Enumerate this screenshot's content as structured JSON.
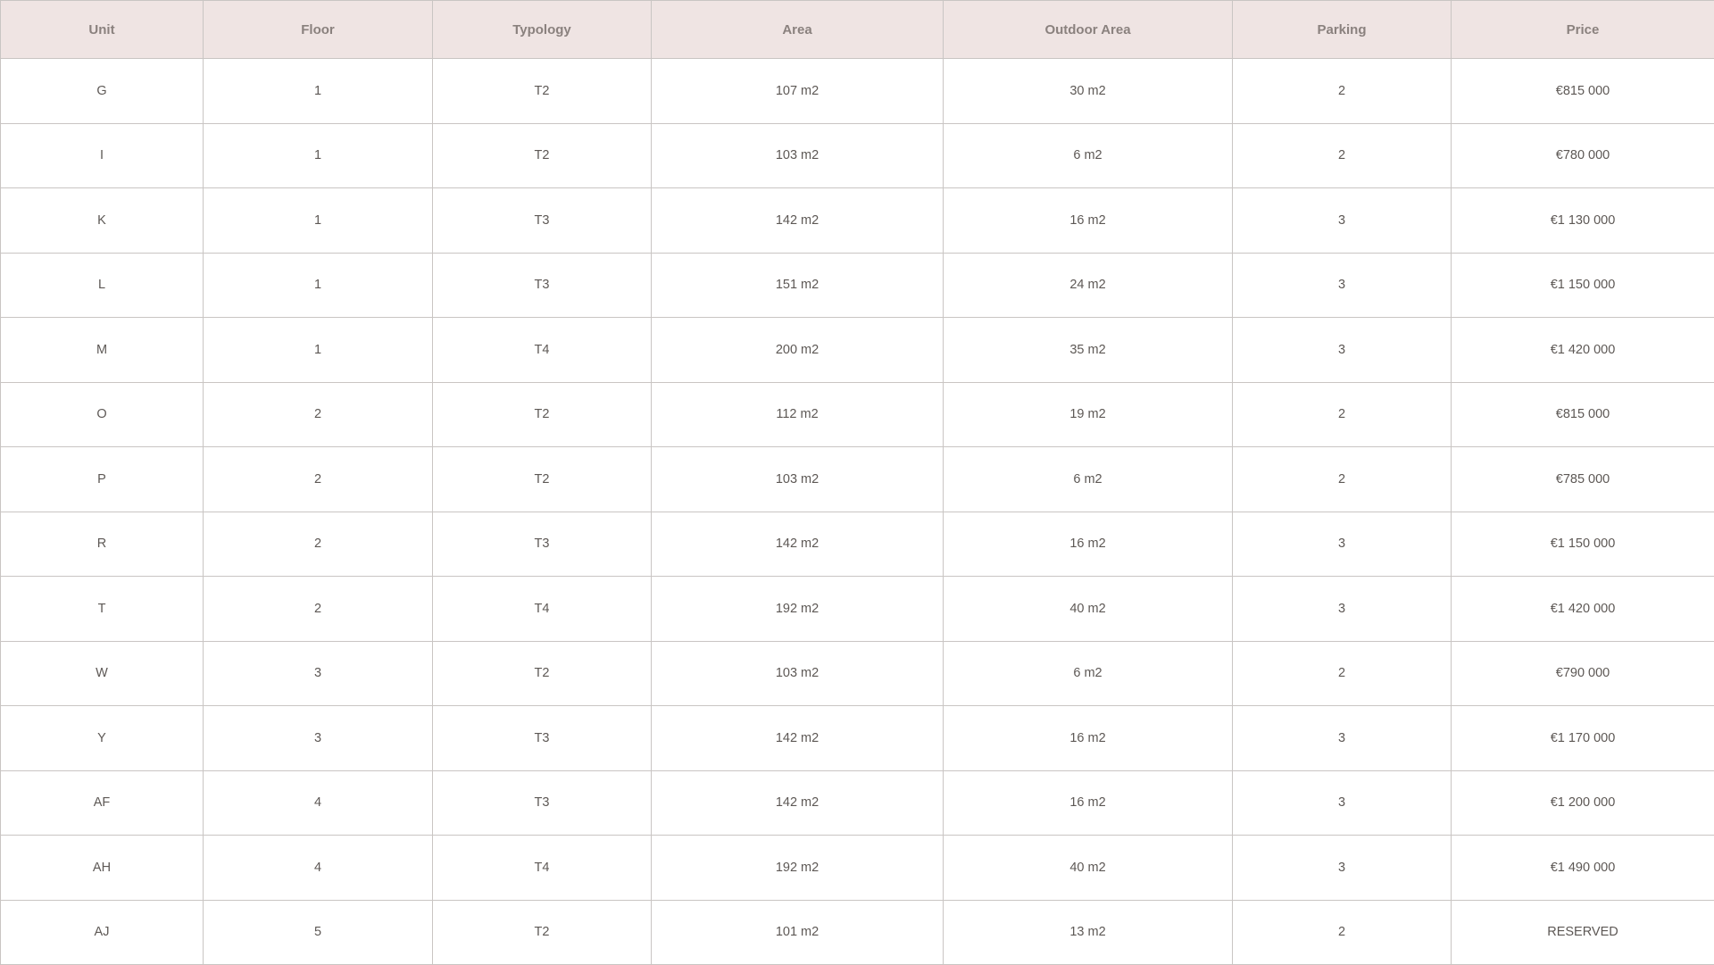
{
  "table": {
    "columns": [
      "Unit",
      "Floor",
      "Typology",
      "Area",
      "Outdoor Area",
      "Parking",
      "Price"
    ],
    "rows": [
      [
        "G",
        "1",
        "T2",
        "107 m2",
        "30 m2",
        "2",
        "€815 000"
      ],
      [
        "I",
        "1",
        "T2",
        "103 m2",
        "6 m2",
        "2",
        "€780 000"
      ],
      [
        "K",
        "1",
        "T3",
        "142 m2",
        "16 m2",
        "3",
        "€1 130 000"
      ],
      [
        "L",
        "1",
        "T3",
        "151 m2",
        "24 m2",
        "3",
        "€1 150 000"
      ],
      [
        "M",
        "1",
        "T4",
        "200 m2",
        "35 m2",
        "3",
        "€1 420 000"
      ],
      [
        "O",
        "2",
        "T2",
        "112 m2",
        "19 m2",
        "2",
        "€815 000"
      ],
      [
        "P",
        "2",
        "T2",
        "103 m2",
        "6 m2",
        "2",
        "€785 000"
      ],
      [
        "R",
        "2",
        "T3",
        "142 m2",
        "16 m2",
        "3",
        "€1 150 000"
      ],
      [
        "T",
        "2",
        "T4",
        "192 m2",
        "40 m2",
        "3",
        "€1 420 000"
      ],
      [
        "W",
        "3",
        "T2",
        "103 m2",
        "6 m2",
        "2",
        "€790 000"
      ],
      [
        "Y",
        "3",
        "T3",
        "142 m2",
        "16 m2",
        "3",
        "€1 170 000"
      ],
      [
        "AF",
        "4",
        "T3",
        "142 m2",
        "16 m2",
        "3",
        "€1 200 000"
      ],
      [
        "AH",
        "4",
        "T4",
        "192 m2",
        "40 m2",
        "3",
        "€1 490 000"
      ],
      [
        "AJ",
        "5",
        "T2",
        "101 m2",
        "13 m2",
        "2",
        "RESERVED"
      ]
    ]
  },
  "colors": {
    "header_background": "#efe4e3",
    "header_text": "#8a817e",
    "cell_text": "#5d5855",
    "border": "#c9c5c3"
  }
}
